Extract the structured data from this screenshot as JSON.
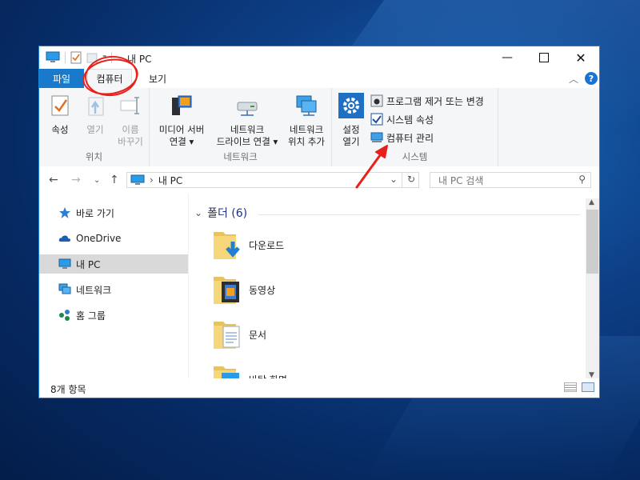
{
  "window": {
    "title": "내 PC"
  },
  "tabs": {
    "file": "파일",
    "computer": "컴퓨터",
    "view": "보기"
  },
  "ribbon": {
    "location": {
      "label": "위치",
      "properties": "속성",
      "open": "열기",
      "rename_l1": "이름",
      "rename_l2": "바꾸기"
    },
    "network": {
      "label": "네트워크",
      "media_l1": "미디어 서버",
      "media_l2": "연결",
      "map_l1": "네트워크",
      "map_l2": "드라이브 연결",
      "add_l1": "네트워크",
      "add_l2": "위치 추가"
    },
    "system": {
      "label": "시스템",
      "settings_l1": "설정",
      "settings_l2": "열기",
      "uninstall": "프로그램 제거 또는 변경",
      "sysprops": "시스템 속성",
      "manage": "컴퓨터 관리"
    }
  },
  "address": {
    "path": "내 PC",
    "search_placeholder": "내 PC 검색"
  },
  "nav": {
    "quick": "바로 가기",
    "onedrive": "OneDrive",
    "thispc": "내 PC",
    "network": "네트워크",
    "homegroup": "홈 그룹"
  },
  "content": {
    "group_header": "폴더 (6)",
    "folders": [
      "다운로드",
      "동영상",
      "문서",
      "바탕 화면"
    ]
  },
  "status": {
    "count": "8개 항목"
  },
  "colors": {
    "accent": "#1979ca",
    "annotation": "#e8201c"
  }
}
